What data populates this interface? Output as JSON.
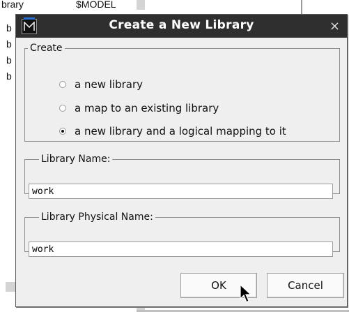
{
  "background": {
    "row0_left": "brary",
    "row0_right": "$MODEL",
    "side_letters": [
      "b",
      "b",
      "b",
      "b"
    ]
  },
  "dialog": {
    "title": "Create a New Library",
    "close_glyph": "×",
    "create_group": {
      "legend": "Create",
      "options": [
        {
          "label": "a new library",
          "selected": false
        },
        {
          "label": "a map to an existing library",
          "selected": false
        },
        {
          "label": "a new library and a logical mapping to it",
          "selected": true
        }
      ]
    },
    "library_name": {
      "legend": "Library Name:",
      "value": "work"
    },
    "physical_name": {
      "legend": "Library Physical Name:",
      "value": "work"
    },
    "ok_label": "OK",
    "cancel_label": "Cancel"
  },
  "icons": {
    "app": "modelsim-m-icon",
    "close": "close-icon",
    "pointer": "mouse-pointer-icon"
  }
}
